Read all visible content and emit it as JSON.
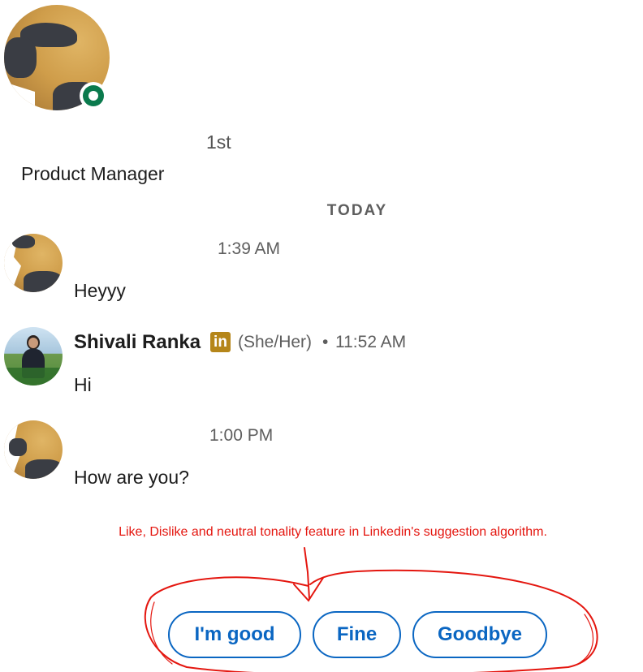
{
  "profile": {
    "degree": "1st",
    "headline": "Product Manager",
    "presence": "online"
  },
  "conversation": {
    "day_divider": "TODAY",
    "messages": [
      {
        "time": "1:39 AM",
        "text": "Heyyy"
      },
      {
        "name": "Shivali Ranka",
        "badge": "in",
        "pronouns": "(She/Her)",
        "separator": "•",
        "time": "11:52 AM",
        "text": "Hi"
      },
      {
        "time": "1:00 PM",
        "text": "How are you?"
      }
    ]
  },
  "annotation": {
    "text": "Like, Dislike and neutral tonality feature in Linkedin's suggestion algorithm.",
    "color": "#e4160f"
  },
  "suggested_replies": [
    "I'm good",
    "Fine",
    "Goodbye"
  ],
  "colors": {
    "accent": "#0a66c2",
    "presence_green": "#0a7a4d",
    "linkedin_badge": "#b5861a"
  }
}
